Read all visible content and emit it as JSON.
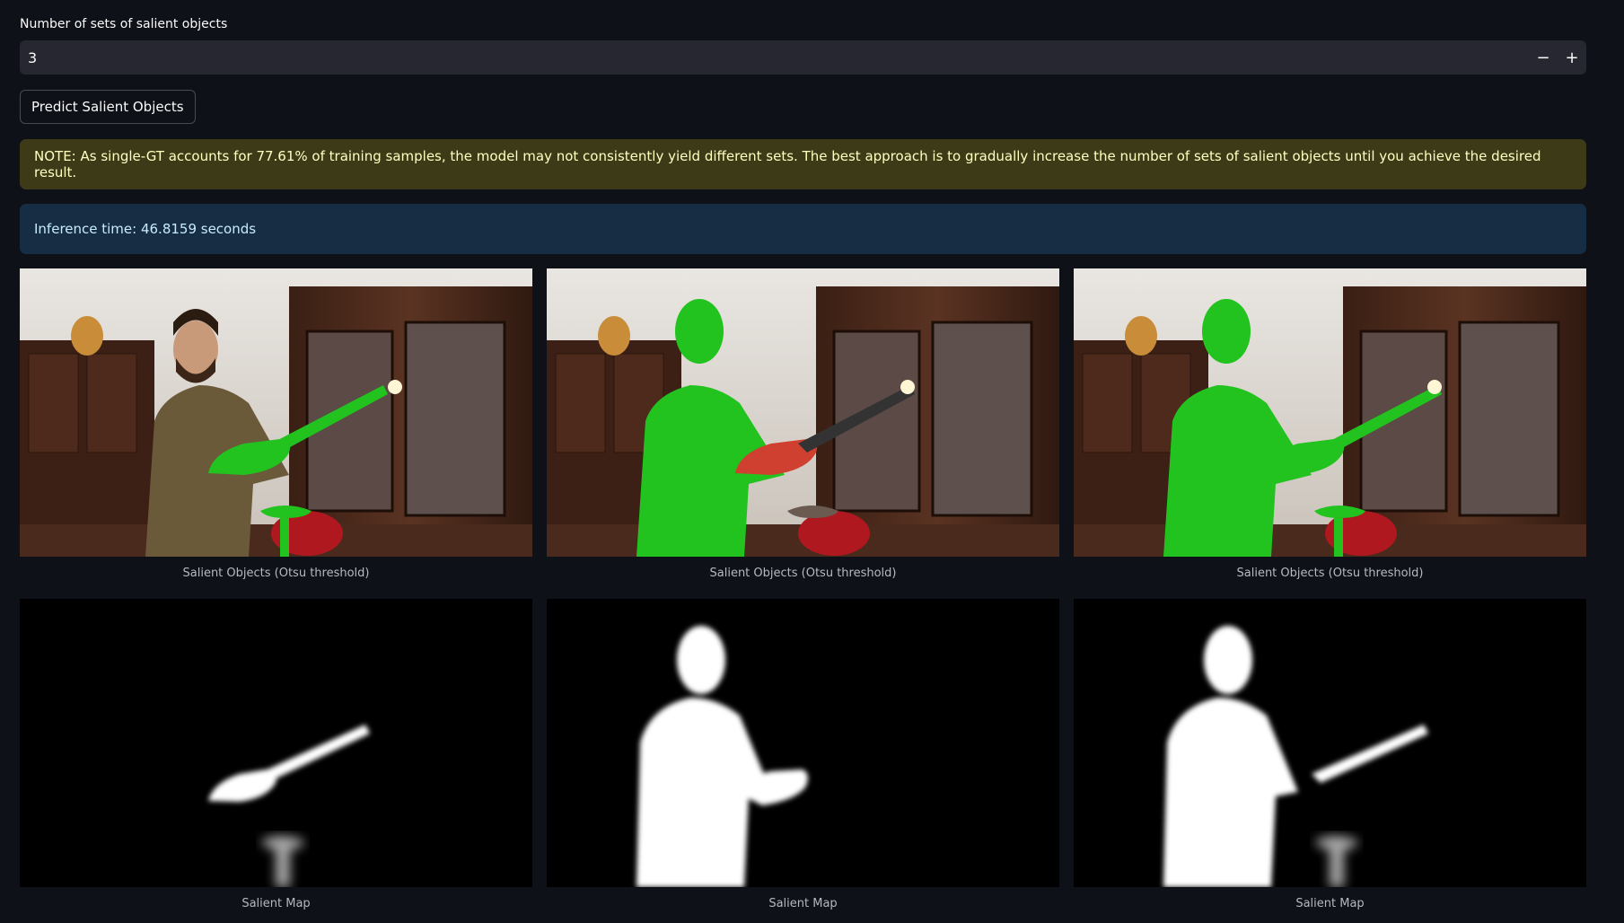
{
  "input": {
    "label": "Number of sets of salient objects",
    "value": "3",
    "decrement_label": "−",
    "increment_label": "+"
  },
  "predict_button": {
    "label": "Predict Salient Objects"
  },
  "alerts": {
    "note": "NOTE: As single-GT accounts for 77.61% of training samples, the model may not consistently yield different sets. The best approach is to gradually increase the number of sets of salient objects until you achieve the desired result.",
    "inference": "Inference time: 46.8159 seconds"
  },
  "results": {
    "overlays": [
      {
        "caption": "Salient Objects (Otsu threshold)",
        "highlight": "lighter-and-bowl"
      },
      {
        "caption": "Salient Objects (Otsu threshold)",
        "highlight": "person"
      },
      {
        "caption": "Salient Objects (Otsu threshold)",
        "highlight": "person-lighter-and-bowl"
      }
    ],
    "maps": [
      {
        "caption": "Salient Map"
      },
      {
        "caption": "Salient Map"
      },
      {
        "caption": "Salient Map"
      }
    ]
  },
  "colors": {
    "background": "#0e1117",
    "input_bg": "#262730",
    "warning_bg": "#3d3a17",
    "info_bg": "#172d43",
    "mask_green": "#22c21f"
  }
}
